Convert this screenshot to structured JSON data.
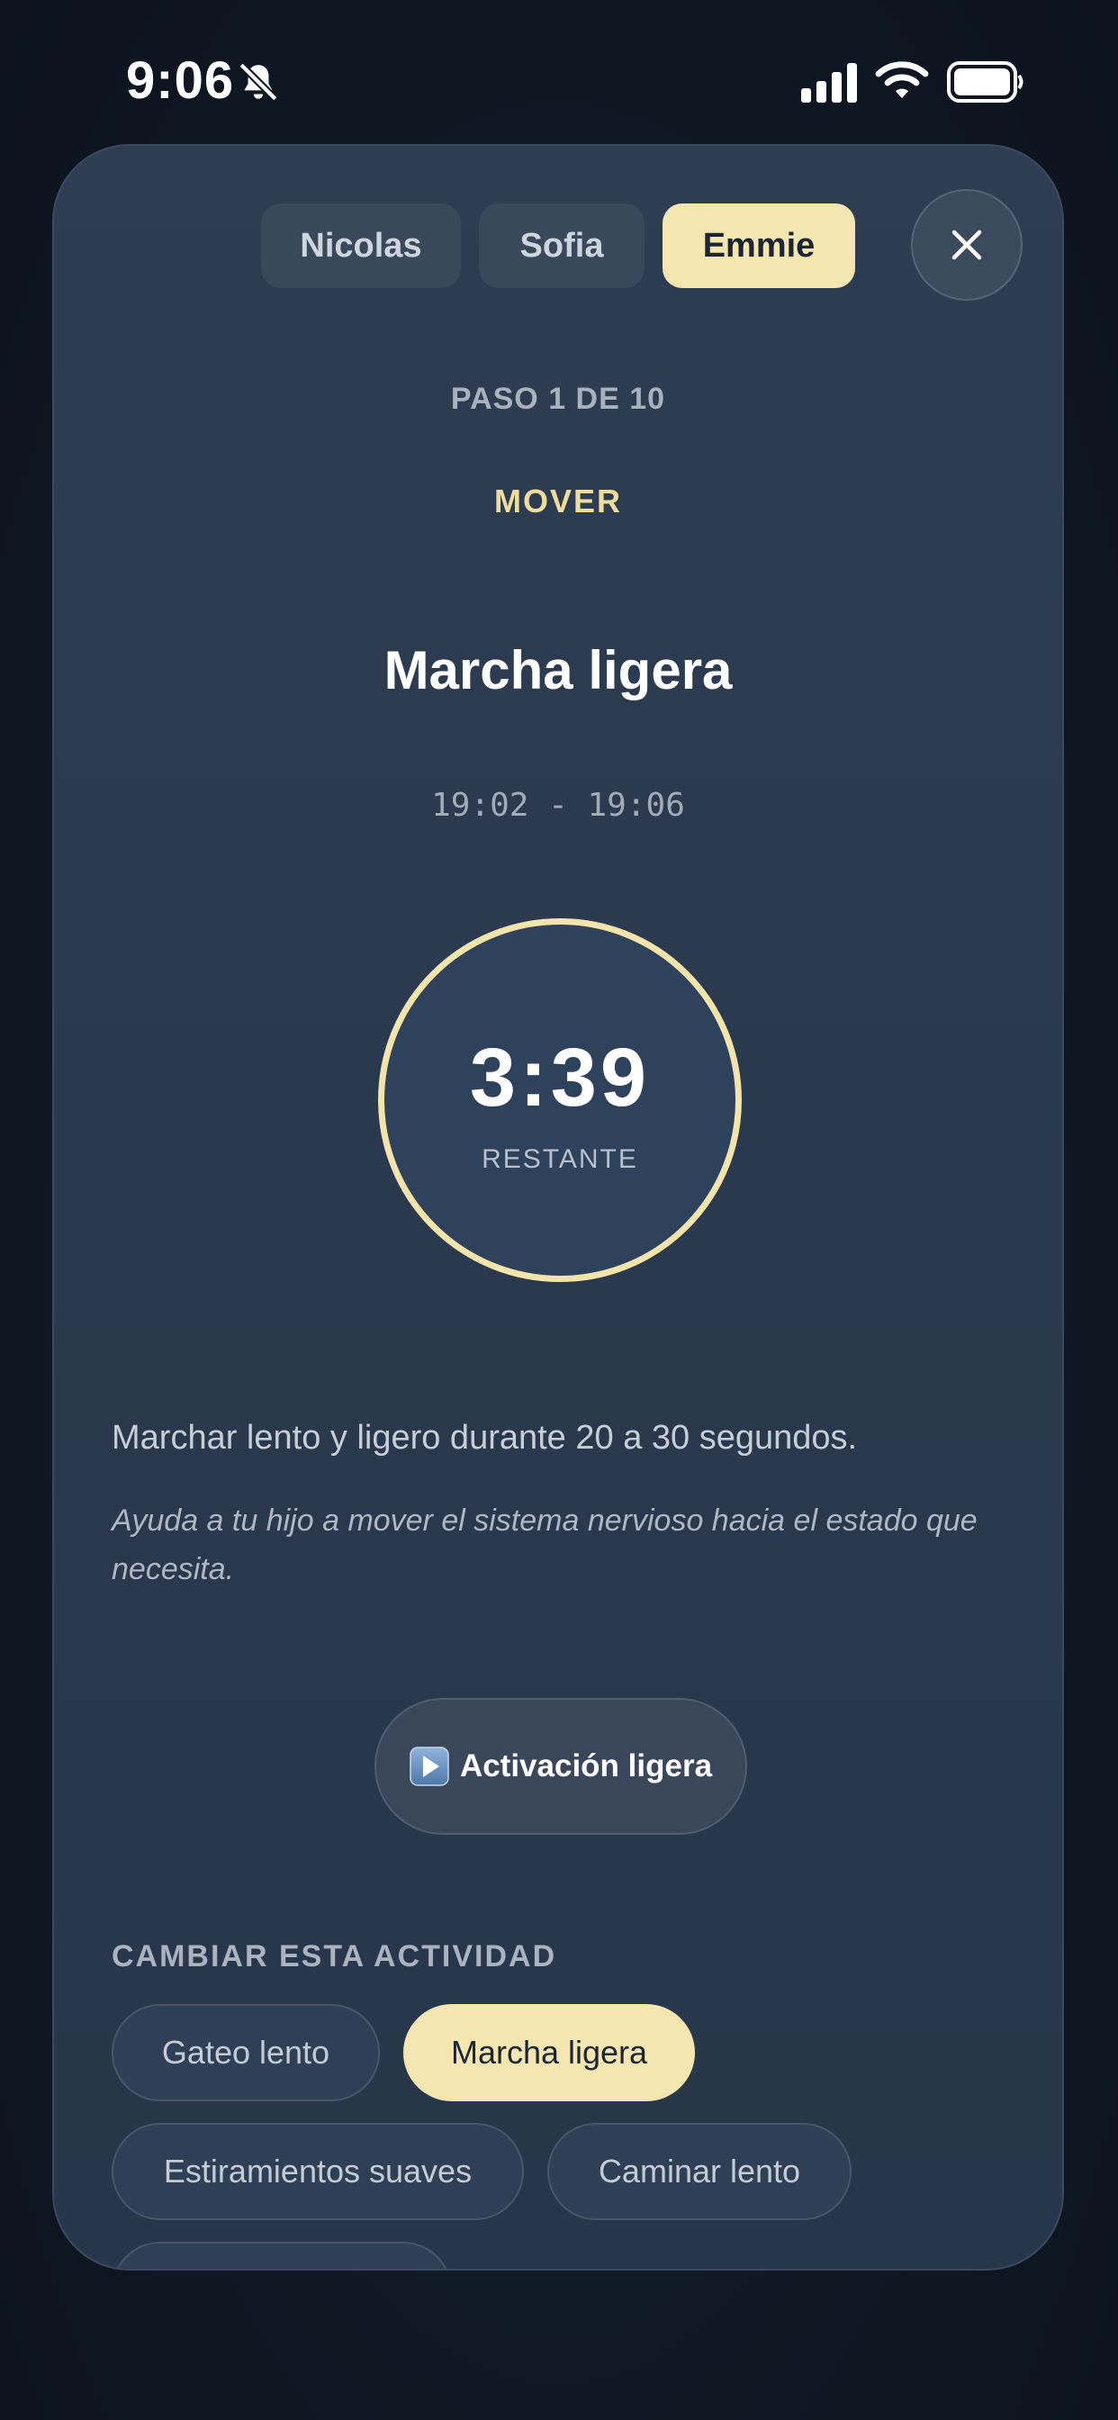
{
  "status_bar": {
    "time": "9:06",
    "icons": [
      "bell-slash-icon",
      "signal-icon",
      "wifi-icon",
      "battery-icon"
    ]
  },
  "profiles": [
    {
      "label": "Nicolas",
      "selected": false
    },
    {
      "label": "Sofia",
      "selected": false
    },
    {
      "label": "Emmie",
      "selected": true
    }
  ],
  "close_icon": "close-icon",
  "step": {
    "label": "PASO 1 DE 10"
  },
  "activity": {
    "category": "MOVER",
    "title": "Marcha ligera",
    "time_range": "19:02 - 19:06",
    "timer": "3:39",
    "timer_caption": "RESTANTE",
    "description": "Marchar lento y ligero durante 20 a 30 segundos.",
    "hint": "Ayuda a tu hijo a mover el sistema nervioso hacia el estado que necesita."
  },
  "play": {
    "icon": "play-icon",
    "label": "Activación ligera"
  },
  "change": {
    "title": "CAMBIAR ESTA ACTIVIDAD",
    "options": [
      {
        "label": "Gateo lento",
        "selected": false
      },
      {
        "label": "Marcha ligera",
        "selected": true
      },
      {
        "label": "Estiramientos suaves",
        "selected": false
      },
      {
        "label": "Caminar lento",
        "selected": false
      },
      {
        "label": "",
        "selected": false
      }
    ]
  },
  "colors": {
    "accent": "#f4e6b0",
    "background": "#0c131d",
    "sheet": "#2c3b50"
  }
}
